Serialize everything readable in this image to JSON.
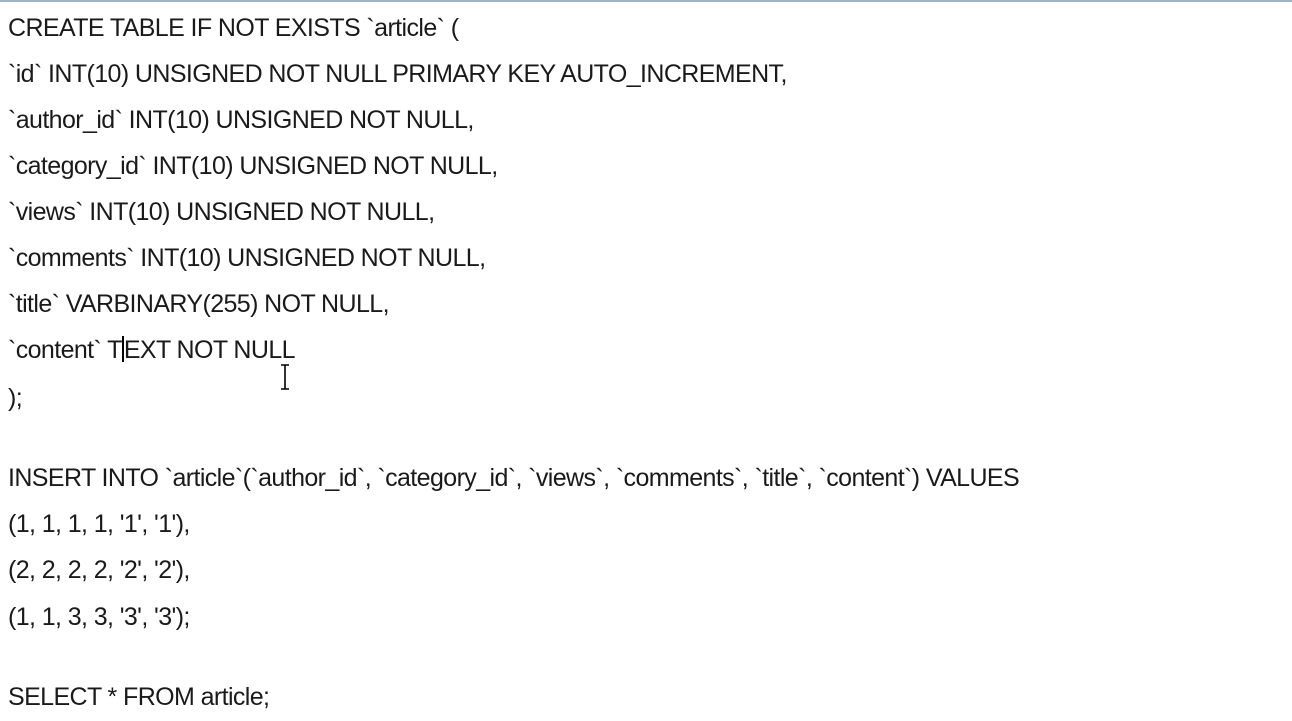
{
  "editor": {
    "lines": [
      {
        "text": "CREATE TABLE IF NOT EXISTS `article` ("
      },
      {
        "text": "`id` INT(10) UNSIGNED NOT NULL PRIMARY KEY AUTO_INCREMENT,"
      },
      {
        "text": "`author_id` INT(10) UNSIGNED NOT NULL,"
      },
      {
        "text": "`category_id` INT(10) UNSIGNED NOT NULL,"
      },
      {
        "text": "`views` INT(10) UNSIGNED NOT NULL,"
      },
      {
        "text": "`comments` INT(10) UNSIGNED NOT NULL,"
      },
      {
        "text": "`title` VARBINARY(255) NOT NULL,"
      },
      {
        "before_caret": "`content` T",
        "after_caret": "EXT NOT NULL"
      },
      {
        "text": ");"
      },
      {
        "text": ""
      },
      {
        "text": "INSERT INTO `article`(`author_id`, `category_id`, `views`, `comments`, `title`, `content`) VALUES"
      },
      {
        "text": "(1, 1, 1, 1, '1', '1'),"
      },
      {
        "text": "(2, 2, 2, 2, '2', '2'),"
      },
      {
        "text": "(1, 1, 3, 3, '3', '3');"
      },
      {
        "text": ""
      },
      {
        "text": "SELECT * FROM article;"
      }
    ]
  },
  "colors": {
    "text": "#1a1a1a",
    "background": "#ffffff",
    "top_border": "#9fb3c8"
  },
  "icons": {
    "mouse_pointer": "i-beam-cursor-icon",
    "text_caret": "text-caret-icon"
  }
}
